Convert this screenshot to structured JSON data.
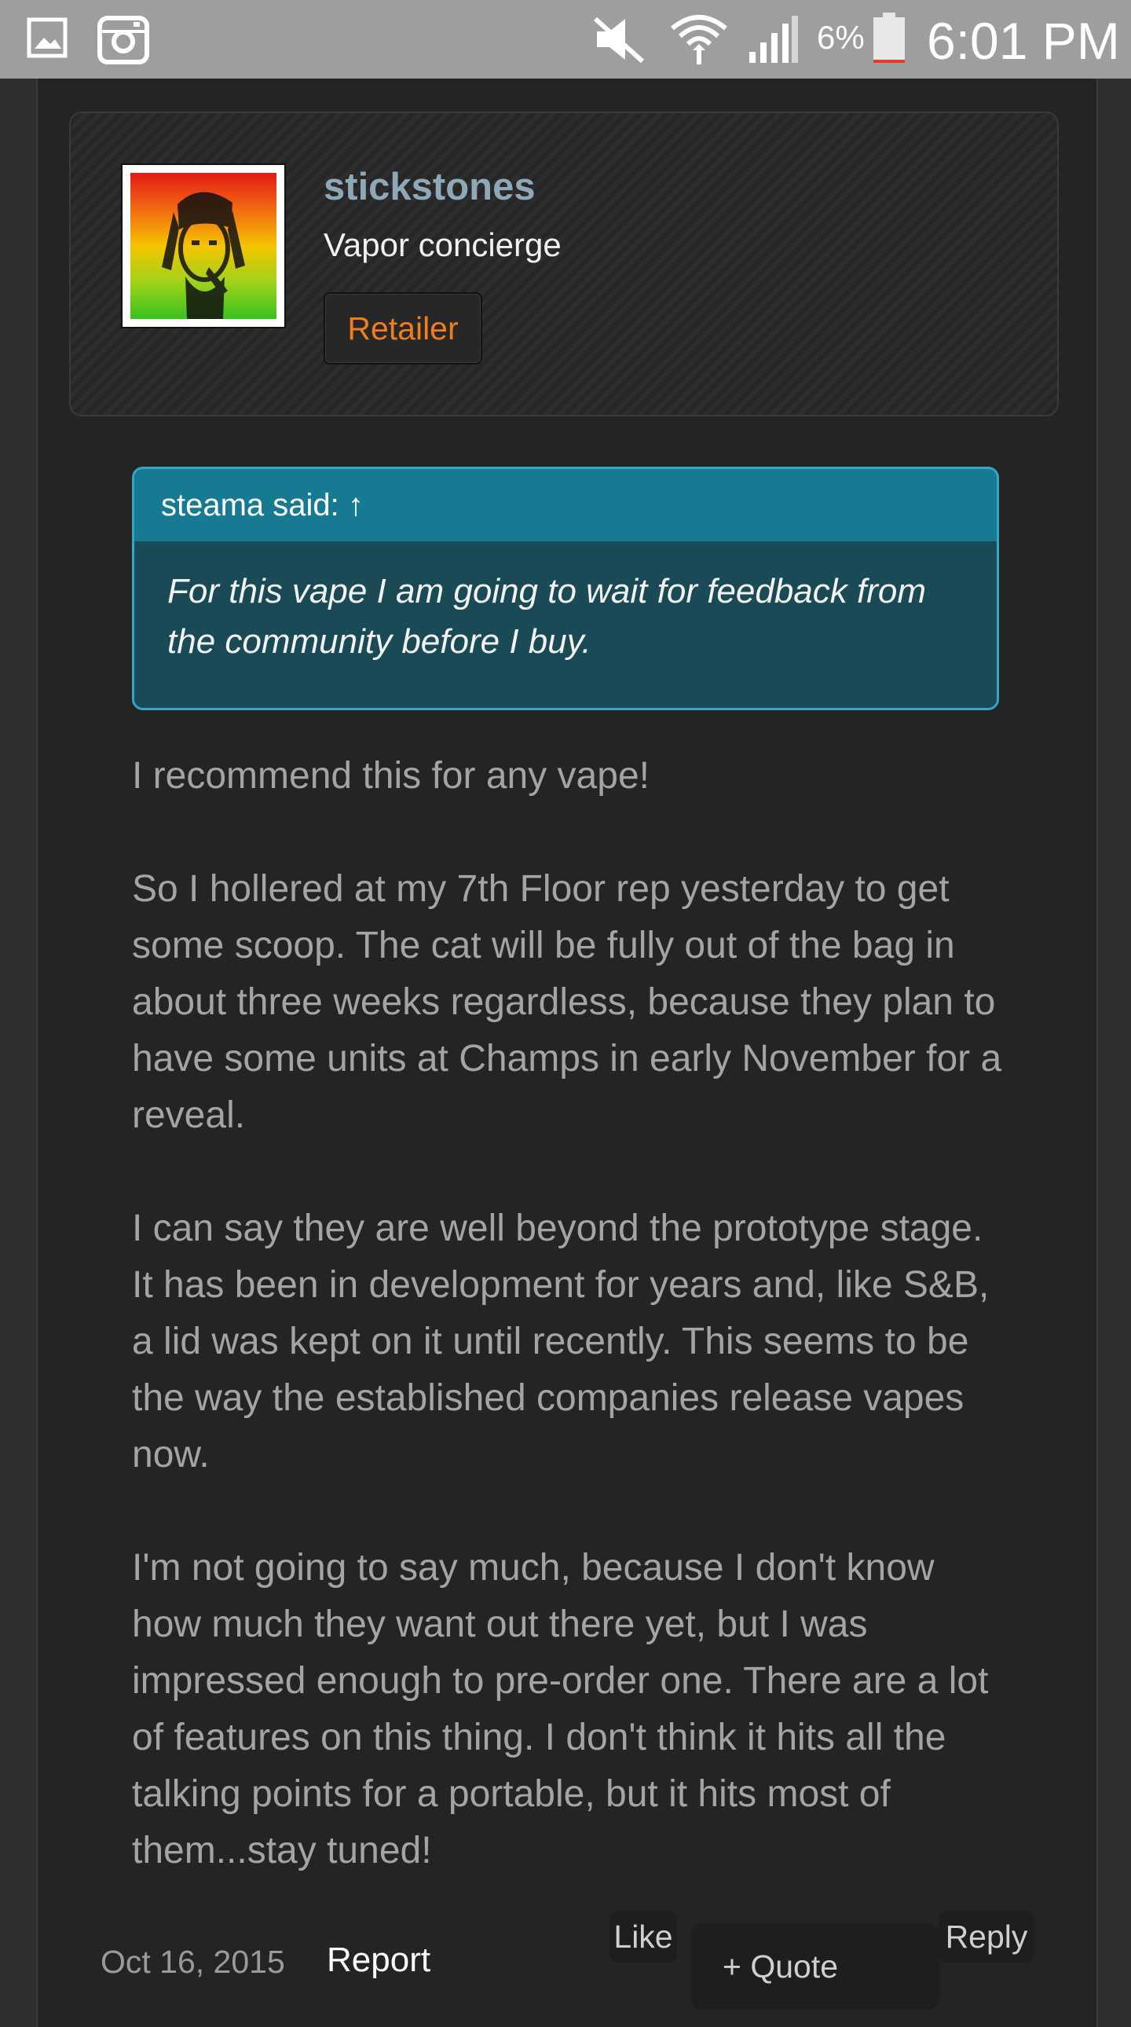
{
  "status_bar": {
    "icons": [
      "gallery-icon",
      "instagram-icon",
      "mute-icon",
      "wifi-icon",
      "signal-icon",
      "battery-icon"
    ],
    "battery_percent": "6%",
    "time": "6:01 PM"
  },
  "user_card": {
    "username": "stickstones",
    "user_title": "Vapor concierge",
    "badge_label": "Retailer"
  },
  "quote": {
    "attribution": "steama said: ↑",
    "text": "For this vape I am going to wait for feedback from the community before I buy."
  },
  "post": {
    "paragraphs": [
      "I recommend this for any vape!",
      "So I hollered at my 7th Floor rep yesterday to get some scoop. The cat will be fully out of the bag in about three weeks regardless, because they plan to have some units at Champs in early November for a reveal.",
      "I can say they are well beyond the prototype stage. It has been in development for years and, like S&B, a lid was kept on it until recently. This seems to be the way the established companies release vapes now.",
      "I'm not going to say much, because I don't know how much they want out there yet, but I was impressed enough to pre-order one. There are a lot of features on this thing. I don't think it hits all the talking points for a portable, but it hits most of them...stay tuned!"
    ]
  },
  "footer": {
    "date": "Oct 16, 2015",
    "report_label": "Report",
    "like_label": "Like",
    "quote_label": "+ Quote",
    "reply_label": "Reply"
  },
  "colors": {
    "status_bar": "#9e9e9e",
    "background": "#242424",
    "username": "#8fa8b8",
    "badge_text": "#f07e1b",
    "quote_border": "#36a6c7",
    "quote_header": "#177a93",
    "quote_body": "#1b4a57",
    "post_text": "#a4a4a4"
  }
}
